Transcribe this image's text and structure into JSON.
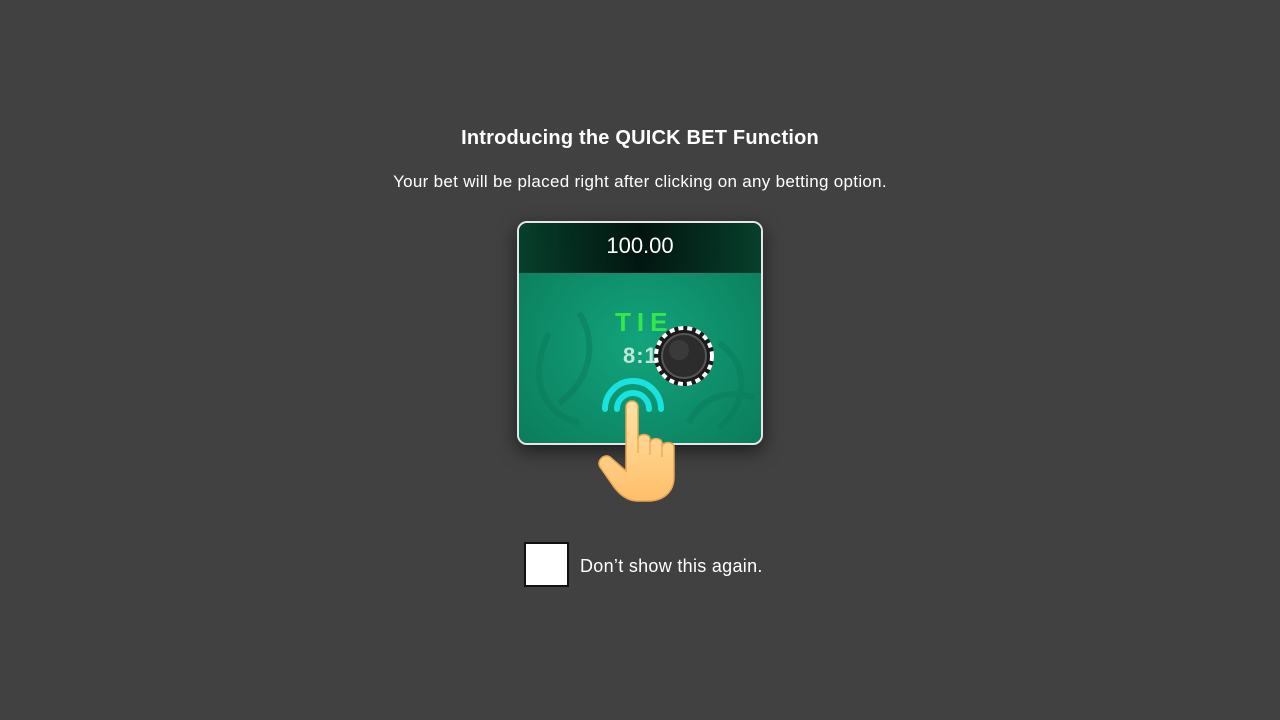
{
  "dialog": {
    "title": "Introducing the QUICK BET Function",
    "description": "Your bet will be placed right after clicking on any betting option.",
    "checkbox_label": "Don’t show this again.",
    "checkbox_checked": false
  },
  "illustration": {
    "bet_amount": "100.00",
    "bet_option": "TIE",
    "odds": "8:1",
    "icons": [
      "casino-chip-icon",
      "tap-ripple-icon",
      "pointing-hand-icon"
    ]
  },
  "colors": {
    "background": "#414141",
    "table_felt": "#0f9670",
    "tie_text": "#34e84a",
    "ripple": "#19e3e0",
    "hand": "#ffc97a"
  }
}
